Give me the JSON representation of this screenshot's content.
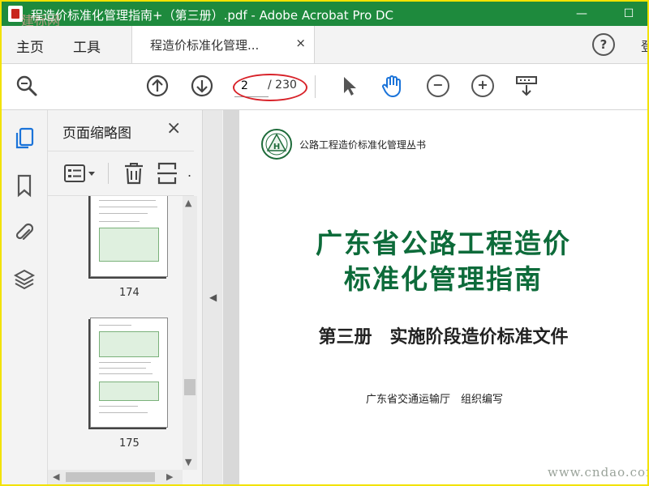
{
  "window": {
    "title": "程造价标准化管理指南+（第三册）.pdf - Adobe Acrobat Pro DC",
    "watermark_mark": "建标网",
    "minimize": "—",
    "maximize": "☐"
  },
  "tabs": {
    "home": "主页",
    "tools": "工具",
    "document": "程造价标准化管理...",
    "close": "×",
    "help": "?",
    "cut_char": "登"
  },
  "toolbar": {
    "page_current": "2",
    "page_total": "/ 230",
    "zoom_out": "−",
    "zoom_in": "+"
  },
  "thumbnail_panel": {
    "title": "页面缩略图",
    "close": "×",
    "more": ".",
    "pages": [
      {
        "number": "174"
      },
      {
        "number": "175"
      }
    ]
  },
  "document": {
    "series": "公路工程造价标准化管理丛书",
    "title_line1": "广东省公路工程造价",
    "title_line2": "标准化管理指南",
    "subtitle": "第三册　实施阶段造价标准文件",
    "publisher": "广东省交通运输厅　组织编写"
  },
  "watermark": "www.cndao.com",
  "colors": {
    "titlebar": "#1e8a3d",
    "title_text": "#0d6b3a",
    "hand_tool": "#1a73d9",
    "annotation_ellipse": "#d8232a"
  }
}
